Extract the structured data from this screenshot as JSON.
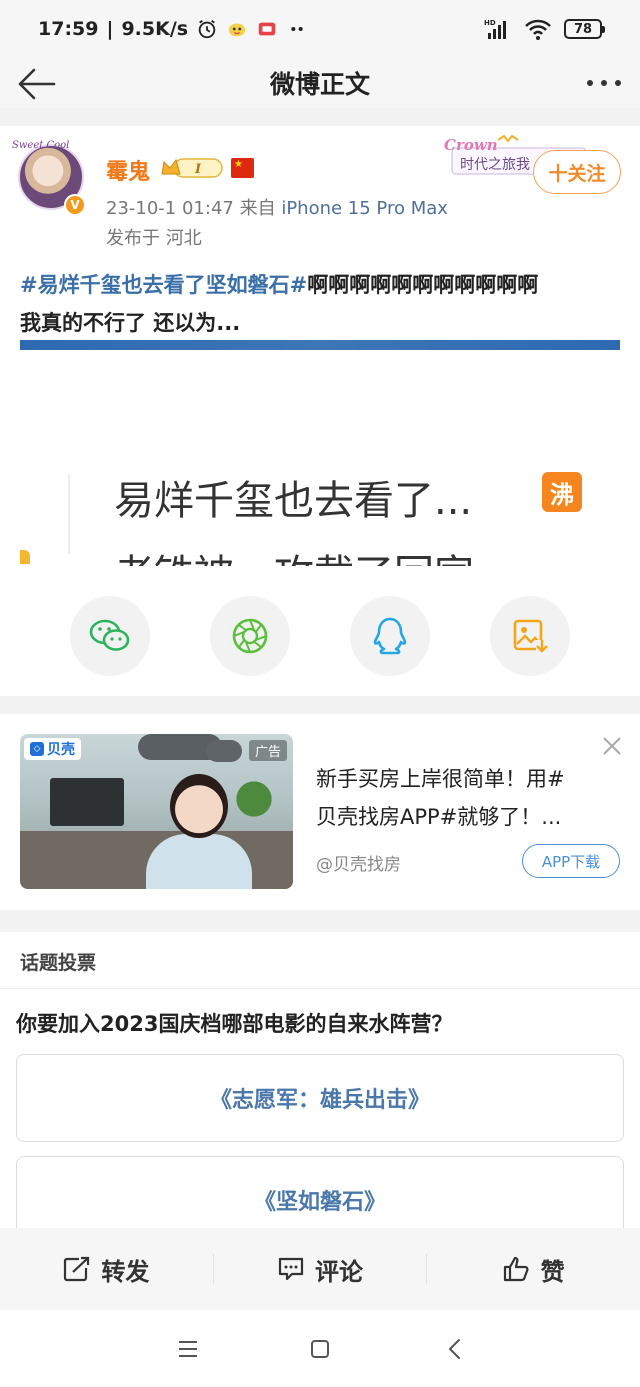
{
  "status_bar": {
    "time": "17:59",
    "network_speed": "9.5K/s",
    "battery": "78",
    "icons": [
      "alarm-icon",
      "app-notification-icon",
      "app-notification-icon",
      "more-dots-icon",
      "hd-signal-icon",
      "wifi-icon",
      "battery-icon"
    ]
  },
  "nav": {
    "title": "微博正文",
    "back_icon": "back-arrow-icon",
    "more_icon": "more-dots-icon"
  },
  "post": {
    "username": "霉鬼",
    "level_badge": "I",
    "timestamp": "23-10-1 01:47",
    "source_prefix": "来自",
    "device": "iPhone 15 Pro Max",
    "location": "发布于 河北",
    "follow_label": "十关注",
    "decor_text": "时代之旅我",
    "decor_crown_text": "Crown",
    "avatar_frame_text": "Sweet Cool",
    "text": {
      "topic": "#易烊千玺也去看了坚如磐石#",
      "line1_rest": "啊啊啊啊啊啊啊啊啊啊啊",
      "line2": "我真的不行了 还以为..."
    },
    "card": {
      "title": "易烊千玺也去看了...",
      "hot_label": "沸",
      "subtitle": "老铁被…攻载了回家"
    },
    "share_buttons": [
      {
        "name": "wechat-share-button",
        "icon": "wechat-icon"
      },
      {
        "name": "moments-share-button",
        "icon": "moments-icon"
      },
      {
        "name": "qq-share-button",
        "icon": "qq-icon"
      },
      {
        "name": "save-image-button",
        "icon": "save-image-icon"
      }
    ]
  },
  "ad": {
    "brand": "贝壳",
    "tag": "广告",
    "title_line1": "新手买房上岸很简单！用#",
    "title_line2": "贝壳找房APP#就够了！...",
    "source": "@贝壳找房",
    "button_label": "APP下载",
    "close_icon": "close-icon"
  },
  "vote": {
    "header": "话题投票",
    "question": "你要加入2023国庆档哪部电影的自来水阵营？",
    "options": [
      "《志愿军：雄兵出击》",
      "《坚如磐石》"
    ]
  },
  "actions": {
    "repost": "转发",
    "comment": "评论",
    "like": "赞"
  },
  "android_nav": {
    "icons": [
      "menu-icon",
      "home-icon",
      "back-icon"
    ]
  },
  "colors": {
    "username": "#f07a1a",
    "topic": "#3a6fa8",
    "follow": "#f08a2a",
    "vote_option_text": "#4b78aa",
    "ad_button": "#4a90d9"
  }
}
